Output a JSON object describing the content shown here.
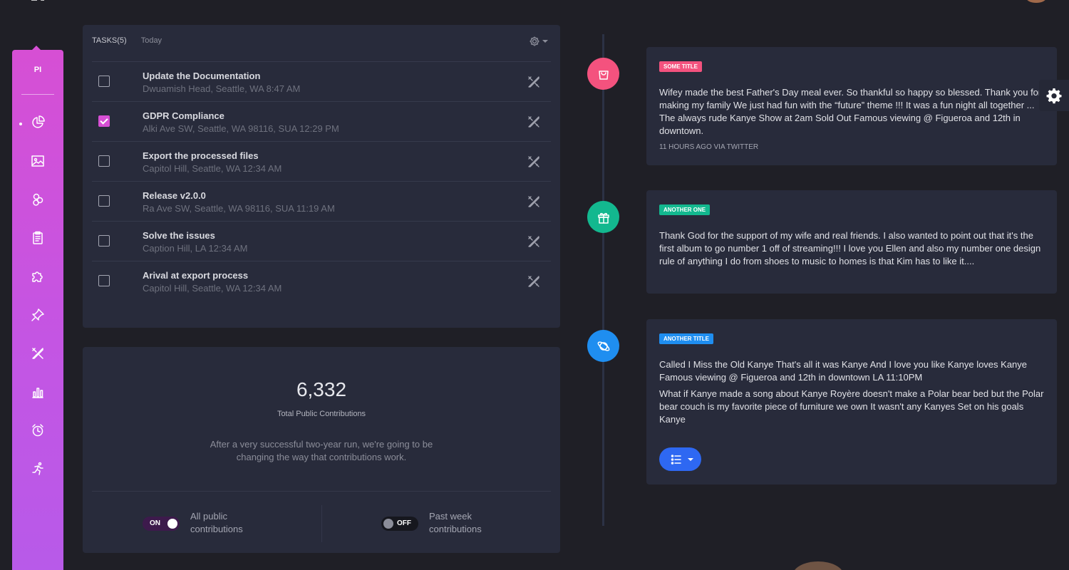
{
  "sidebar": {
    "title": "PI",
    "items": [
      {
        "icon": "pie-chart-icon"
      },
      {
        "icon": "image-icon"
      },
      {
        "icon": "shapes-icon"
      },
      {
        "icon": "clipboard-icon"
      },
      {
        "icon": "puzzle-icon"
      },
      {
        "icon": "pin-icon"
      },
      {
        "icon": "tools-icon"
      },
      {
        "icon": "bar-chart-icon"
      },
      {
        "icon": "alarm-clock-icon"
      },
      {
        "icon": "runner-icon"
      }
    ],
    "gradient": [
      "#d64fd4",
      "#b75ae9"
    ]
  },
  "tasks": {
    "header": "TASKS(5)",
    "filter": "Today",
    "items": [
      {
        "title": "Update the Documentation",
        "subtitle": "Dwuamish Head, Seattle, WA 8:47 AM",
        "checked": false
      },
      {
        "title": "GDPR Compliance",
        "subtitle": "Alki Ave SW, Seattle, WA 98116, SUA 12:29 PM",
        "checked": true
      },
      {
        "title": "Export the processed files",
        "subtitle": "Capitol Hill, Seattle, WA 12:34 AM",
        "checked": false
      },
      {
        "title": "Release v2.0.0",
        "subtitle": "Ra Ave SW, Seattle, WA 98116, SUA 11:19 AM",
        "checked": false
      },
      {
        "title": "Solve the issues",
        "subtitle": "Caption Hill, LA 12:34 AM",
        "checked": false
      },
      {
        "title": "Arival at export process",
        "subtitle": "Capitol Hill, Seattle, WA 12:34 AM",
        "checked": false
      }
    ]
  },
  "contributions": {
    "total": "6,332",
    "label": "Total Public Contributions",
    "description": "After a very successful two-year run, we're going to be changing the way that contributions work.",
    "toggle_all": {
      "state": "ON",
      "label": "All public contributions"
    },
    "toggle_week": {
      "state": "OFF",
      "label": "Past week contributions"
    }
  },
  "timeline": [
    {
      "badge": "SOME TITLE",
      "badge_color": "#f4527e",
      "icon": "shopping-bag-icon",
      "icon_color": "#f4527e",
      "text": "Wifey made the best Father's Day meal ever. So thankful so happy so blessed. Thank you for making my family We just had fun with the “future” theme !!! It was a fun night all together ... The always rude Kanye Show at 2am Sold Out Famous viewing @ Figueroa and 12th in downtown.",
      "meta": "11 HOURS AGO VIA TWITTER"
    },
    {
      "badge": "ANOTHER ONE",
      "badge_color": "#13b88f",
      "icon": "gift-icon",
      "icon_color": "#13b88f",
      "text": "Thank God for the support of my wife and real friends. I also wanted to point out that it's the first album to go number 1 off of streaming!!! I love you Ellen and also my number one design rule of anything I do from shoes to music to homes is that Kim has to like it...."
    },
    {
      "badge": "ANOTHER TITLE",
      "badge_color": "#1f8ef0",
      "icon": "planet-icon",
      "icon_color": "#1f8ef0",
      "text": "Called I Miss the Old Kanye That's all it was Kanye And I love you like Kanye loves Kanye Famous viewing @ Figueroa and 12th in downtown LA 11:10PM",
      "text2": "What if Kanye made a song about Kanye Royère doesn't make a Polar bear bed but the Polar bear couch is my favorite piece of furniture we own It wasn't any Kanyes Set on his goals Kanye",
      "button_icon": "list-icon"
    }
  ]
}
